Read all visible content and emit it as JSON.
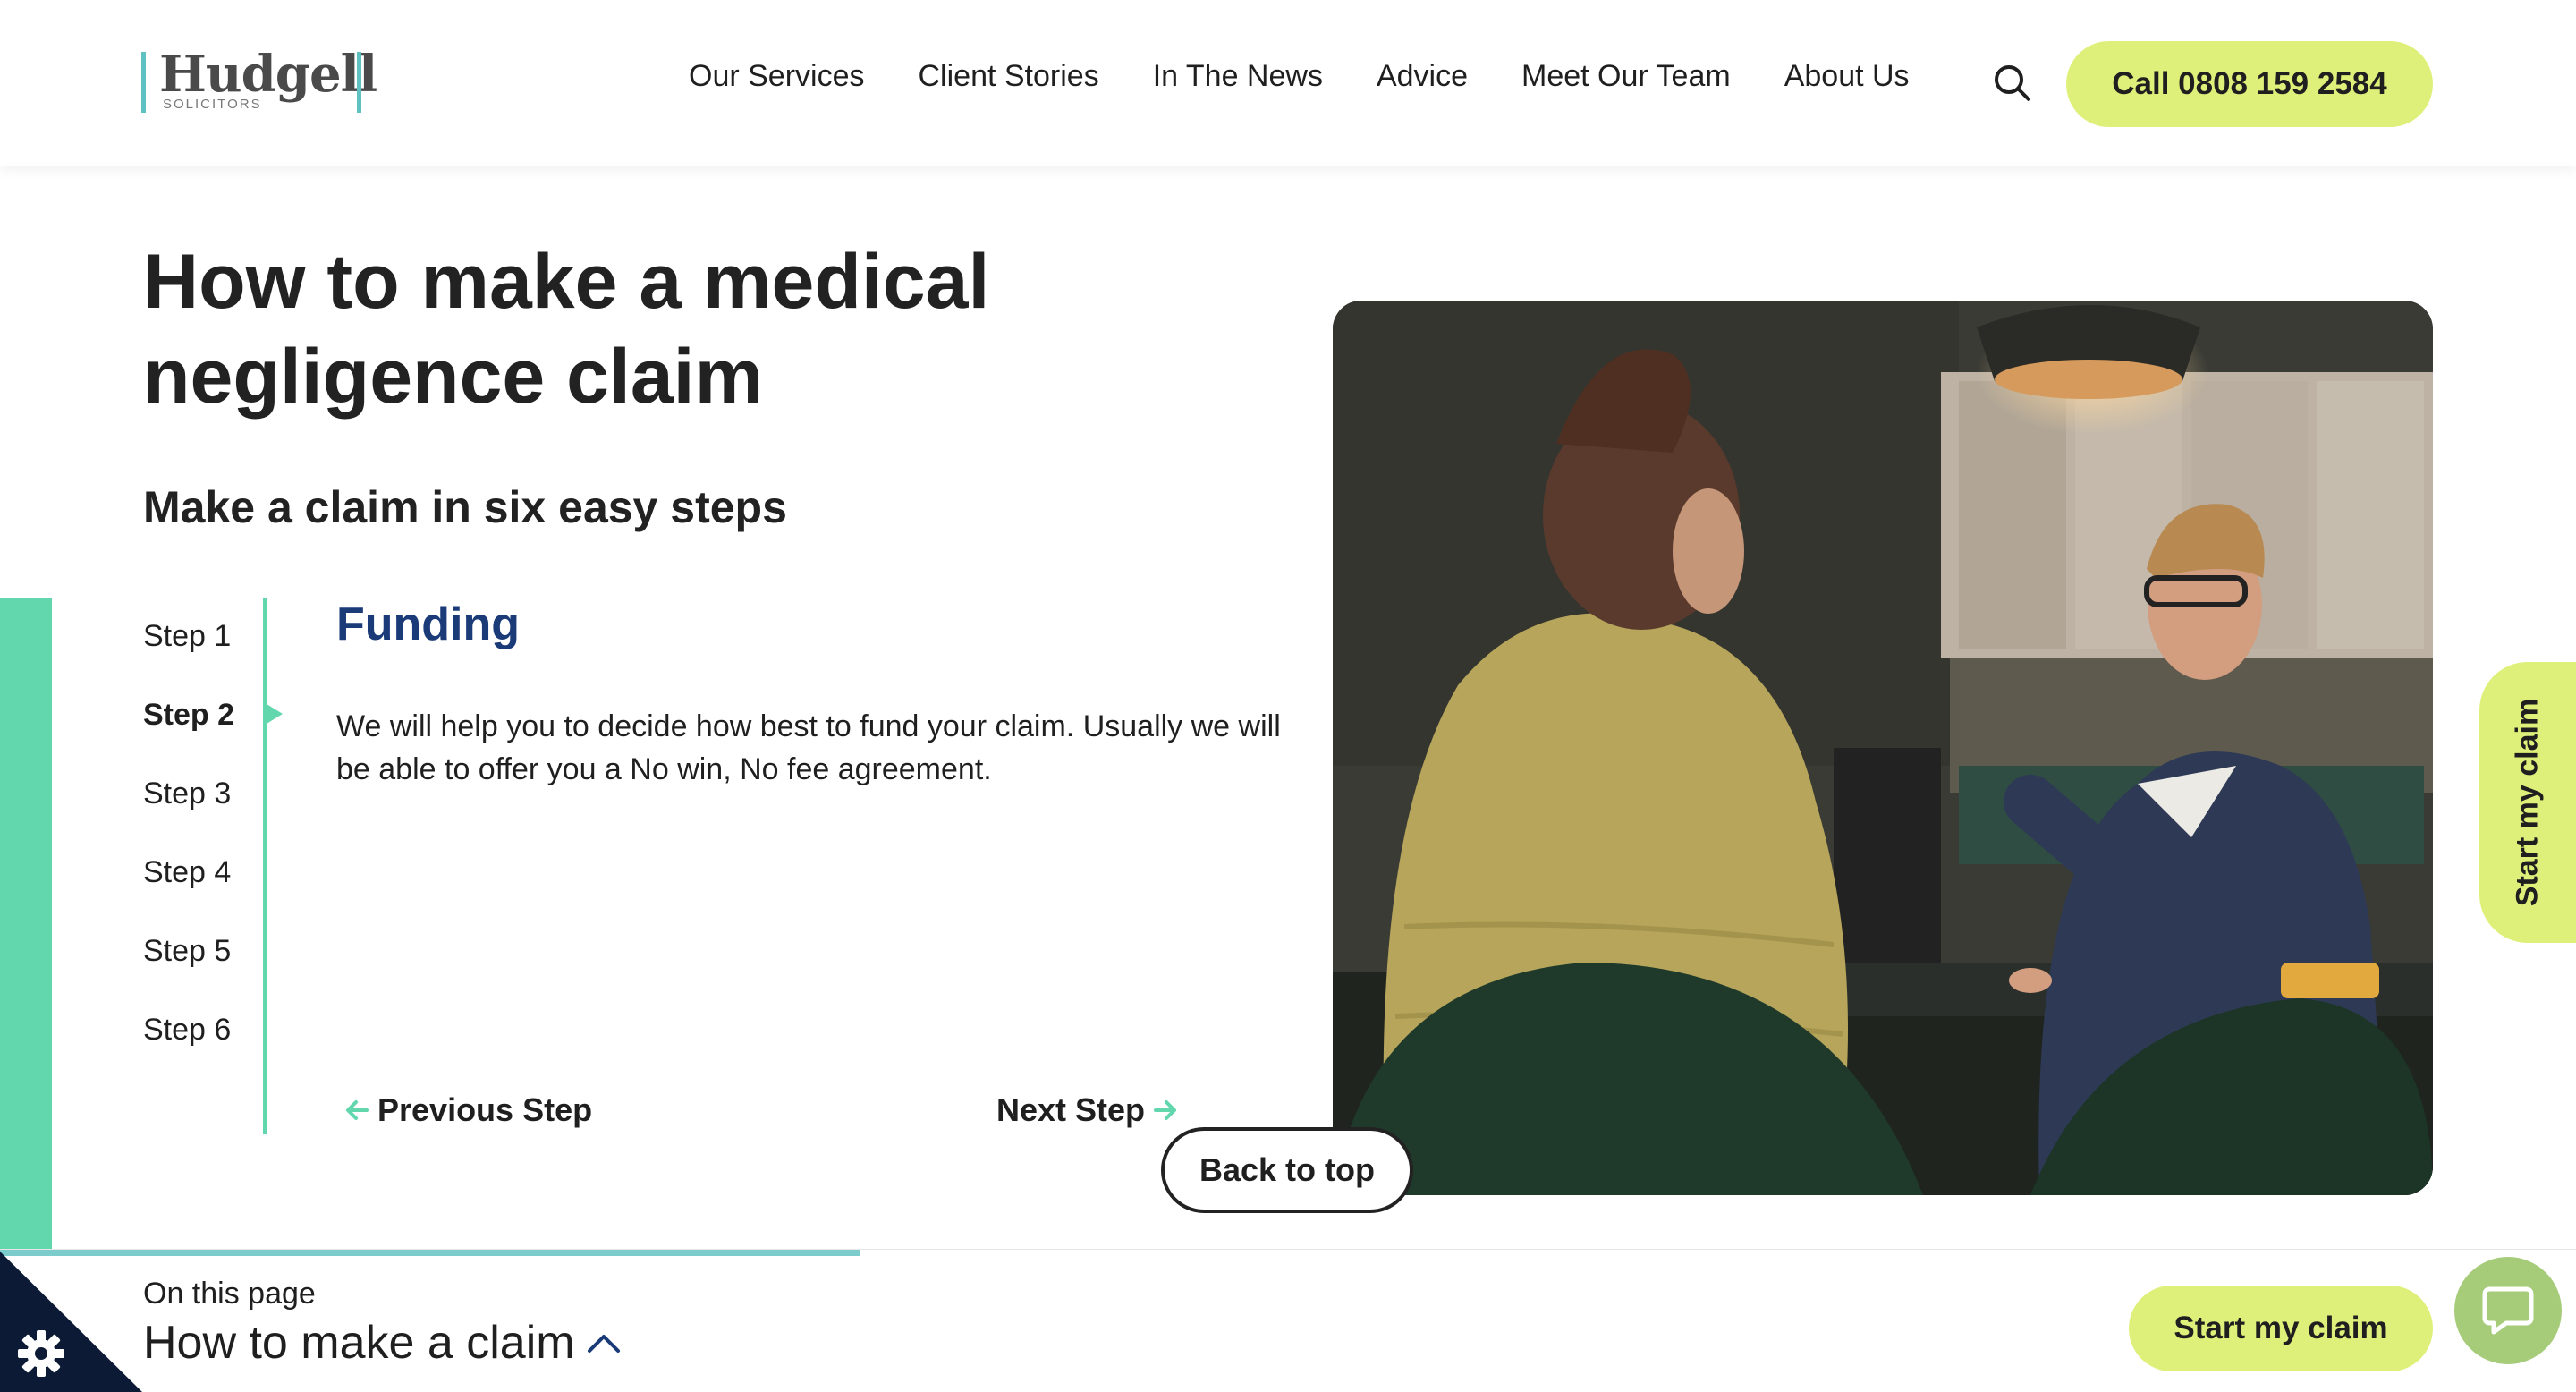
{
  "header": {
    "logo_word": "Hudgell",
    "logo_sub": "SOLICITORS",
    "nav": [
      "Our Services",
      "Client Stories",
      "In The News",
      "Advice",
      "Meet Our Team",
      "About Us"
    ],
    "call_label": "Call 0808 159 2584"
  },
  "hero": {
    "title": "How to make a medical negligence claim",
    "subtitle": "Make a claim in six easy steps"
  },
  "steps": {
    "items": [
      "Step 1",
      "Step 2",
      "Step 3",
      "Step 4",
      "Step 5",
      "Step 6"
    ],
    "active_index": 1,
    "heading": "Funding",
    "body": "We will help you to decide how best to fund your claim. Usually we will be able to offer you a No win, No fee agreement.",
    "prev_label": "Previous Step",
    "next_label": "Next Step"
  },
  "back_to_top": "Back to top",
  "side_tab": "Start my claim",
  "bottom": {
    "on_this_page": "On this page",
    "current_section": "How to make a claim",
    "start_label": "Start my claim"
  },
  "colors": {
    "accent_green": "#62d6ad",
    "lime": "#dff07a",
    "navy": "#1a3a78",
    "teal": "#7ccccc"
  },
  "icons": [
    "search-icon",
    "arrow-left-icon",
    "arrow-right-icon",
    "chevron-up-icon",
    "gear-icon",
    "chat-icon"
  ]
}
